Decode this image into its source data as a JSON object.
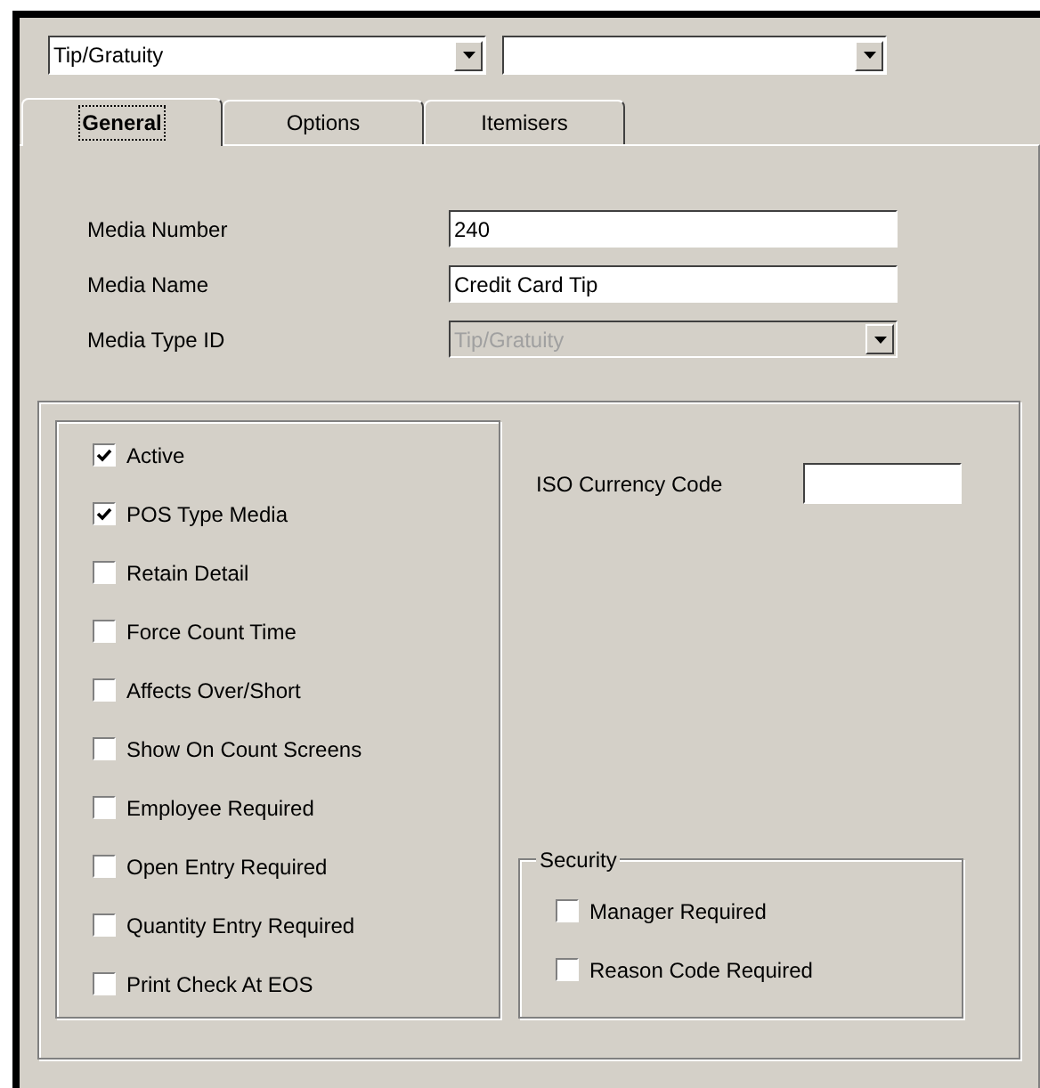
{
  "filter": {
    "value": "Tip/Gratuity"
  },
  "tabs": [
    {
      "label": "General",
      "selected": true
    },
    {
      "label": "Options",
      "selected": false
    },
    {
      "label": "Itemisers",
      "selected": false
    }
  ],
  "fields": [
    {
      "kind": "text",
      "label": "Media Number",
      "value": "240",
      "disabled": false
    },
    {
      "kind": "text",
      "label": "Media Name",
      "value": "Credit Card Tip",
      "disabled": false
    },
    {
      "kind": "combo",
      "label": "Media Type ID",
      "value": "Tip/Gratuity",
      "disabled": true
    }
  ],
  "flags": [
    {
      "label": "Active",
      "checked": true
    },
    {
      "label": "POS Type Media",
      "checked": true
    },
    {
      "label": "Retain Detail",
      "checked": false
    },
    {
      "label": "Force Count Time",
      "checked": false
    },
    {
      "label": "Affects Over/Short",
      "checked": false
    },
    {
      "label": "Show On Count Screens",
      "checked": false
    },
    {
      "label": "Employee Required",
      "checked": false
    },
    {
      "label": "Open Entry Required",
      "checked": false
    },
    {
      "label": "Quantity Entry Required",
      "checked": false
    },
    {
      "label": "Print Check At EOS",
      "checked": false
    }
  ],
  "iso_currency_code": {
    "label": "ISO Currency Code"
  },
  "security": {
    "title": "Security",
    "items": [
      {
        "label": "Manager Required",
        "checked": false
      },
      {
        "label": "Reason Code Required",
        "checked": false
      }
    ]
  }
}
